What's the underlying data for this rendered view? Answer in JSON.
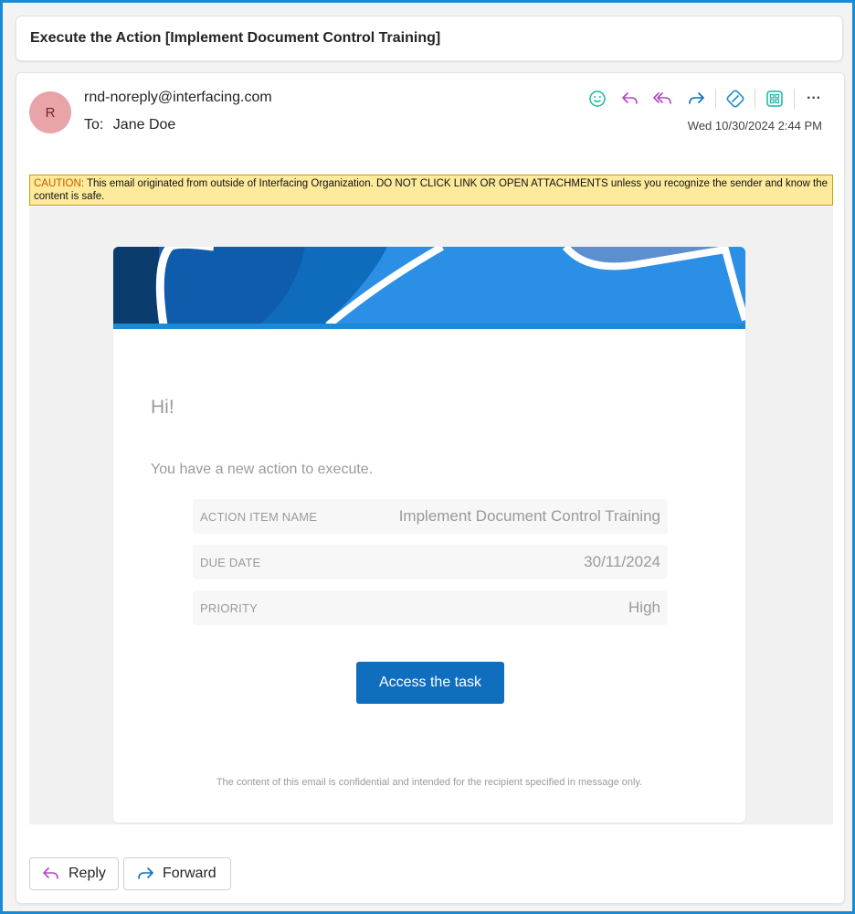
{
  "subject": "Execute the Action [Implement Document Control Training]",
  "sender": {
    "initial": "R",
    "email": "rnd-noreply@interfacing.com",
    "to_label": "To:",
    "to_name": "Jane Doe",
    "timestamp": "Wed 10/30/2024 2:44 PM"
  },
  "toolbar": {
    "icons": [
      "emoji-icon",
      "reply-icon",
      "reply-all-icon",
      "forward-icon",
      "link-icon",
      "apps-icon",
      "more-icon"
    ],
    "more_label": "···"
  },
  "caution": {
    "label": "CAUTION:",
    "text": " This email originated from outside of Interfacing Organization. DO NOT CLICK LINK OR OPEN ATTACHMENTS unless you recognize the sender and know the content is safe."
  },
  "email_body": {
    "greeting": "Hi!",
    "intro": "You have a new action to execute.",
    "details": [
      {
        "key": "ACTION ITEM NAME",
        "value": "Implement Document Control Training"
      },
      {
        "key": "DUE DATE",
        "value": "30/11/2024"
      },
      {
        "key": "PRIORITY",
        "value": "High"
      }
    ],
    "cta_label": "Access the task",
    "footer": "The content of this email is confidential and intended for the recipient specified in message only."
  },
  "actions": {
    "reply": "Reply",
    "forward": "Forward"
  },
  "colors": {
    "frame_border": "#1a8ad4",
    "accent_blue": "#106ebe",
    "avatar_bg": "#e8a4a8",
    "caution_bg": "#fdea9b",
    "caution_label": "#c55a00",
    "reply_icon": "#b146c2",
    "forward_icon": "#0f6cbd",
    "emoji_icon": "#14b8a6"
  }
}
